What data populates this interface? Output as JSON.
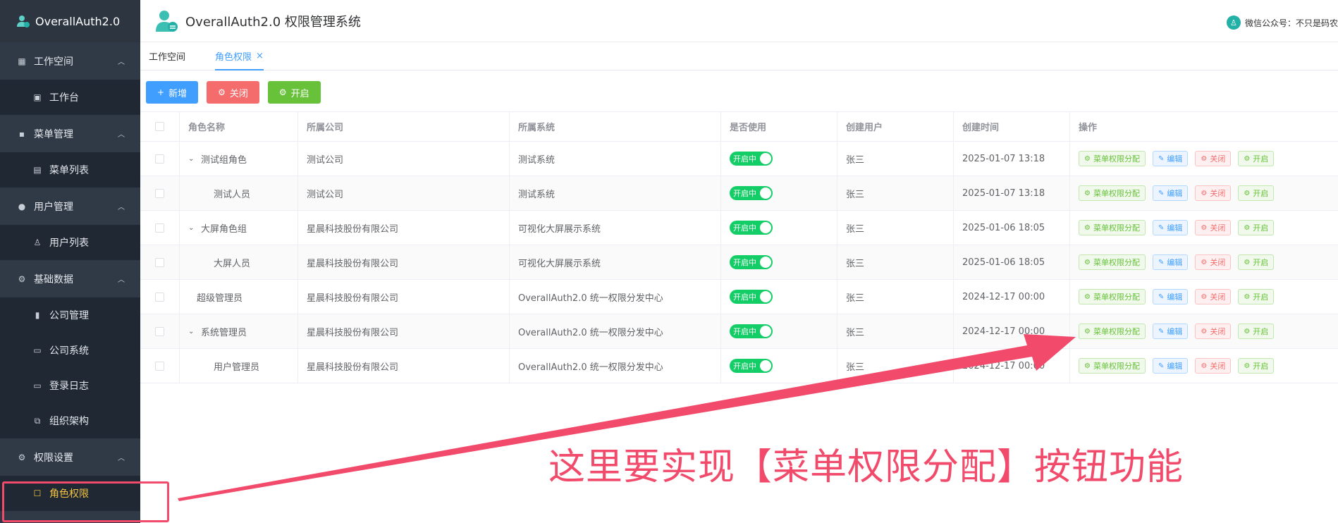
{
  "brand": {
    "name": "OverallAuth2.0"
  },
  "header": {
    "title": "OverallAuth2.0 权限管理系统",
    "right_text": "微信公众号：不只是码农"
  },
  "sidebar": {
    "groups": [
      {
        "label": "工作空间",
        "icon": "building-icon",
        "items": [
          {
            "label": "工作台",
            "icon": "dashboard-icon"
          }
        ]
      },
      {
        "label": "菜单管理",
        "icon": "grid-icon",
        "items": [
          {
            "label": "菜单列表",
            "icon": "list-icon"
          }
        ]
      },
      {
        "label": "用户管理",
        "icon": "user-icon",
        "items": [
          {
            "label": "用户列表",
            "icon": "person-icon"
          }
        ]
      },
      {
        "label": "基础数据",
        "icon": "gear-icon",
        "items": [
          {
            "label": "公司管理",
            "icon": "bar-chart-icon"
          },
          {
            "label": "公司系统",
            "icon": "monitor-icon"
          },
          {
            "label": "登录日志",
            "icon": "monitor-icon"
          },
          {
            "label": "组织架构",
            "icon": "org-icon"
          }
        ]
      },
      {
        "label": "权限设置",
        "icon": "gear-icon",
        "items": [
          {
            "label": "角色权限",
            "icon": "edit-icon",
            "active": true
          }
        ]
      }
    ]
  },
  "tabs": [
    {
      "label": "工作空间",
      "active": false
    },
    {
      "label": "角色权限",
      "active": true,
      "close": "×"
    }
  ],
  "toolbar": {
    "add_label": "新增",
    "add_icon": "+",
    "close_label": "关闭",
    "open_label": "开启"
  },
  "table": {
    "headers": [
      "角色名称",
      "所属公司",
      "所属系统",
      "是否使用",
      "创建用户",
      "创建时间",
      "操作"
    ],
    "switch_label": "开启中",
    "actions": {
      "assign": "菜单权限分配",
      "edit": "编辑",
      "close": "关闭",
      "open": "开启"
    },
    "rows": [
      {
        "name": "测试组角色",
        "level": 1,
        "expand": "⌄",
        "company": "测试公司",
        "system": "测试系统",
        "user": "张三",
        "time": "2025-01-07 13:18"
      },
      {
        "name": "测试人员",
        "level": 2,
        "expand": "",
        "company": "测试公司",
        "system": "测试系统",
        "user": "张三",
        "time": "2025-01-07 13:18"
      },
      {
        "name": "大屏角色组",
        "level": 1,
        "expand": "⌄",
        "company": "星晨科技股份有限公司",
        "system": "可视化大屏展示系统",
        "user": "张三",
        "time": "2025-01-06 18:05"
      },
      {
        "name": "大屏人员",
        "level": 2,
        "expand": "",
        "company": "星晨科技股份有限公司",
        "system": "可视化大屏展示系统",
        "user": "张三",
        "time": "2025-01-06 18:05"
      },
      {
        "name": "超级管理员",
        "level": 1,
        "expand": "",
        "company": "星晨科技股份有限公司",
        "system": "OverallAuth2.0 统一权限分发中心",
        "user": "张三",
        "time": "2024-12-17 00:00"
      },
      {
        "name": "系统管理员",
        "level": 1,
        "expand": "⌄",
        "company": "星晨科技股份有限公司",
        "system": "OverallAuth2.0 统一权限分发中心",
        "user": "张三",
        "time": "2024-12-17 00:00"
      },
      {
        "name": "用户管理员",
        "level": 2,
        "expand": "",
        "company": "星晨科技股份有限公司",
        "system": "OverallAuth2.0 统一权限分发中心",
        "user": "张三",
        "time": "2024-12-17 00:00"
      }
    ]
  },
  "annotation": {
    "text": "这里要实现【菜单权限分配】按钮功能",
    "color": "#f14a6a"
  },
  "colors": {
    "sidebar_bg": "#303a46",
    "primary": "#409eff",
    "danger": "#f56c6c",
    "success": "#67c23a",
    "switch_on": "#13ce66",
    "active_menu": "#f5c542"
  }
}
